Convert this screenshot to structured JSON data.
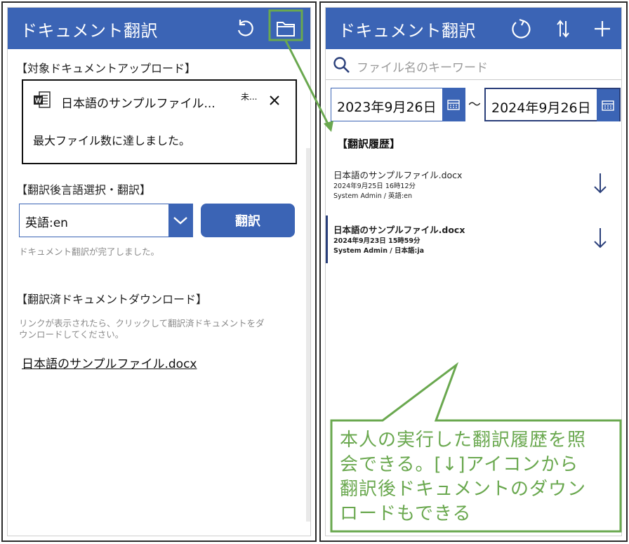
{
  "left": {
    "title": "ドキュメント翻訳",
    "upload_section_label": "【対象ドキュメントアップロード】",
    "uploaded_file": {
      "name": "日本語のサンプルファイル...",
      "status": "未...",
      "type_icon": "word-doc-icon"
    },
    "upload_message": "最大ファイル数に達しました。",
    "translate_section_label": "【翻訳後言語選択・翻訳】",
    "language_select": {
      "value": "英語:en"
    },
    "translate_button": "翻訳",
    "translate_status": "ドキュメント翻訳が完了しました。",
    "download_section_label": "【翻訳済ドキュメントダウンロード】",
    "download_hint_line1": "リンクが表示されたら、クリックして翻訳済ドキュメントをダ",
    "download_hint_line2": "ウンロードしてください。",
    "download_link": "日本語のサンプルファイル.docx"
  },
  "right": {
    "title": "ドキュメント翻訳",
    "search_placeholder": "ファイル名のキーワード",
    "date_from": "2023年9月26日",
    "date_to": "2024年9月26日",
    "date_separator": "～",
    "history_title": "【翻訳履歴】",
    "history": [
      {
        "name": "日本語のサンプルファイル.docx",
        "date": "2024年9月25日 16時12分",
        "who": "System Admin / 英語:en"
      },
      {
        "name": "日本語のサンプルファイル.docx",
        "date": "2024年9月23日 15時59分",
        "who": "System Admin / 日本語:ja"
      }
    ]
  },
  "callout": {
    "line1": "本人の実行した翻訳履歴を照",
    "line2": "会できる。[↓]アイコンから",
    "line3": "翻訳後ドキュメントのダウン",
    "line4": "ロードもできる"
  },
  "colors": {
    "brand": "#3b64b5",
    "brand_dark": "#2a3f7a",
    "callout": "#6aa84f"
  }
}
